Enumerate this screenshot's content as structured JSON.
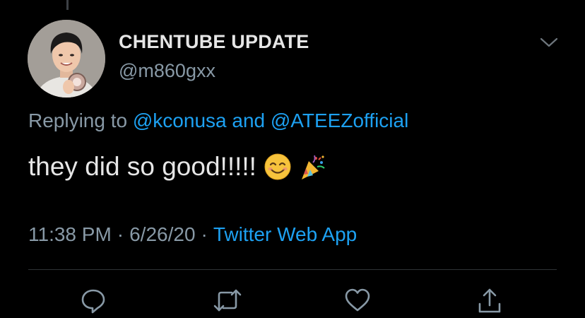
{
  "tweet": {
    "display_name": "CHENTUBE UPDATE",
    "handle": "@m860gxx",
    "replying_prefix": "Replying to",
    "mention_1": "@kconusa",
    "replying_and": "and",
    "mention_2": "@ATEEZofficial",
    "text": "they did so good!!!!!",
    "emojis": [
      "smiling-face-emoji",
      "party-popper-emoji"
    ],
    "time": "11:38 PM",
    "date": "6/26/20",
    "separator": "·",
    "source": "Twitter Web App"
  },
  "actions": [
    "reply-icon",
    "retweet-icon",
    "like-icon",
    "share-icon"
  ],
  "colors": {
    "background": "#000000",
    "text": "#e6e6e6",
    "secondary": "#8899a6",
    "link": "#1da1f2",
    "divider": "#2f3336"
  }
}
